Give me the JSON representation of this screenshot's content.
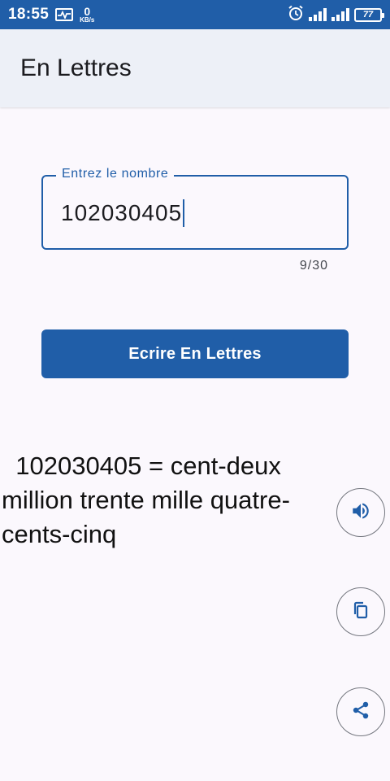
{
  "status_bar": {
    "time": "18:55",
    "speed_value": "0",
    "speed_unit": "KB/s",
    "battery": "77"
  },
  "app_bar": {
    "title": "En Lettres"
  },
  "input": {
    "label": "Entrez le nombre",
    "value": "102030405",
    "counter": "9/30"
  },
  "button": {
    "label": "Ecrire En Lettres"
  },
  "result": {
    "text": "  102030405 = cent-deux million trente mille quatre-cents-cinq"
  },
  "actions": {
    "speak_icon": "volume-up-icon",
    "copy_icon": "copy-icon",
    "share_icon": "share-icon"
  },
  "colors": {
    "primary": "#205ea8",
    "app_bar_bg": "#edf0f7",
    "background": "#fbf8fd",
    "outline": "#74777f"
  }
}
